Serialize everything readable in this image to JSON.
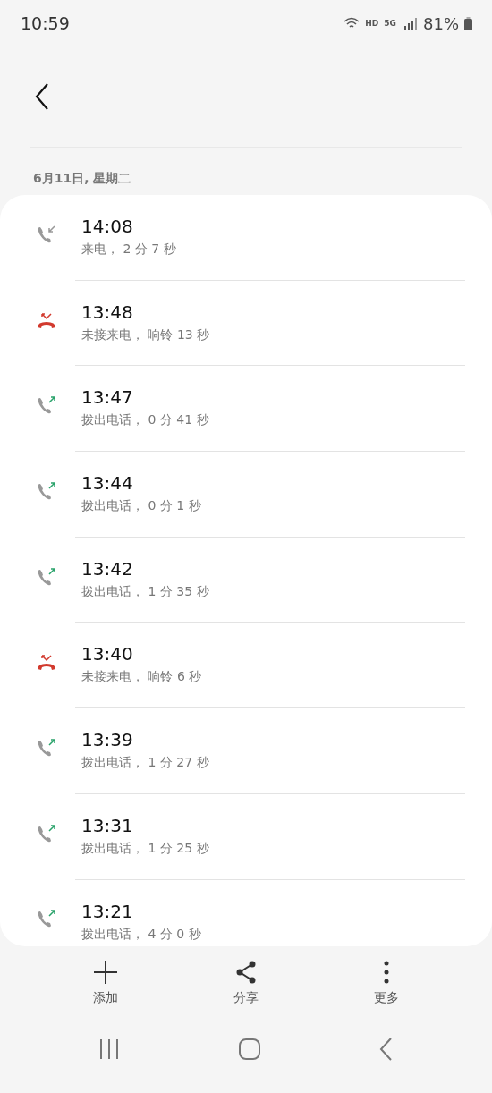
{
  "status_bar": {
    "time": "10:59",
    "hd": "HD",
    "network": "5G",
    "battery": "81%"
  },
  "date_header": "6月11日, 星期二",
  "calls": [
    {
      "kind": "incoming",
      "time": "14:08",
      "detail": "来电， 2 分 7 秒"
    },
    {
      "kind": "missed",
      "time": "13:48",
      "detail": "未接来电， 响铃 13 秒"
    },
    {
      "kind": "outgoing",
      "time": "13:47",
      "detail": "拨出电话， 0 分 41 秒"
    },
    {
      "kind": "outgoing",
      "time": "13:44",
      "detail": "拨出电话， 0 分 1 秒"
    },
    {
      "kind": "outgoing",
      "time": "13:42",
      "detail": "拨出电话， 1 分 35 秒"
    },
    {
      "kind": "missed",
      "time": "13:40",
      "detail": "未接来电， 响铃 6 秒"
    },
    {
      "kind": "outgoing",
      "time": "13:39",
      "detail": "拨出电话， 1 分 27 秒"
    },
    {
      "kind": "outgoing",
      "time": "13:31",
      "detail": "拨出电话， 1 分 25 秒"
    },
    {
      "kind": "outgoing",
      "time": "13:21",
      "detail": "拨出电话， 4 分 0 秒"
    }
  ],
  "actions": [
    {
      "kind": "add",
      "label": "添加"
    },
    {
      "kind": "share",
      "label": "分享"
    },
    {
      "kind": "more",
      "label": "更多"
    }
  ]
}
